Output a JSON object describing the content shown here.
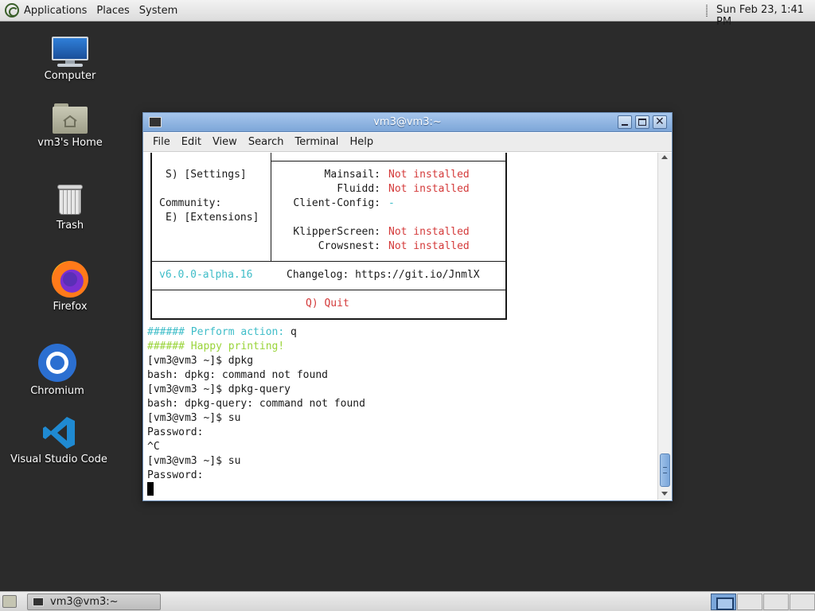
{
  "top_panel": {
    "applications": "Applications",
    "places": "Places",
    "system": "System",
    "clock": "Sun Feb 23,  1:41 PM"
  },
  "desktop_icons": [
    {
      "label": "Computer",
      "icon": "computer-icon"
    },
    {
      "label": "vm3's Home",
      "icon": "home-folder-icon"
    },
    {
      "label": "Trash",
      "icon": "trash-icon"
    },
    {
      "label": "Firefox",
      "icon": "firefox-icon"
    },
    {
      "label": "Chromium",
      "icon": "chromium-icon"
    },
    {
      "label": "Visual Studio Code",
      "icon": "vscode-icon"
    }
  ],
  "terminal": {
    "title": "vm3@vm3:~",
    "menu": [
      "File",
      "Edit",
      "View",
      "Search",
      "Terminal",
      "Help"
    ],
    "box": {
      "settings": "S) [Settings]",
      "community": "Community:",
      "extensions": "E) [Extensions]",
      "components": [
        {
          "name": "Mainsail:",
          "status": "Not installed"
        },
        {
          "name": "Fluidd:",
          "status": "Not installed"
        },
        {
          "name": "Client-Config:",
          "status": "-"
        },
        {
          "name": "KlipperScreen:",
          "status": "Not installed"
        },
        {
          "name": "Crowsnest:",
          "status": "Not installed"
        }
      ],
      "version": "v6.0.0-alpha.16",
      "changelog": "Changelog: https://git.io/JnmlX",
      "quit": "Q) Quit"
    },
    "lines": {
      "perform_prefix": "###### Perform action:",
      "perform_input": " q",
      "happy": "###### Happy printing!",
      "l1": "[vm3@vm3 ~]$ dpkg",
      "l2": "bash: dpkg: command not found",
      "l3": "[vm3@vm3 ~]$ dpkg-query",
      "l4": "bash: dpkg-query: command not found",
      "l5": "[vm3@vm3 ~]$ su",
      "l6": "Password:",
      "l7": "^C",
      "l8": "[vm3@vm3 ~]$ su",
      "l9": "Password:"
    }
  },
  "bottom_panel": {
    "task": "vm3@vm3:~"
  }
}
